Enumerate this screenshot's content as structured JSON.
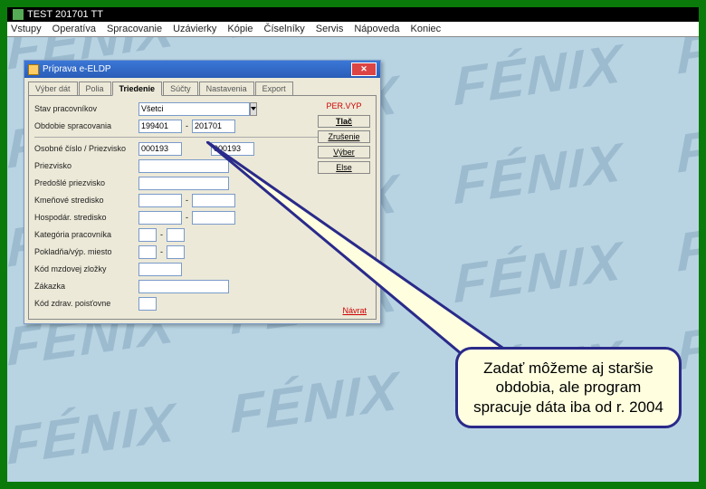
{
  "app": {
    "title": "TEST 201701 TT"
  },
  "menu": [
    "Vstupy",
    "Operatíva",
    "Spracovanie",
    "Uzávierky",
    "Kópie",
    "Číselníky",
    "Servis",
    "Nápoveda",
    "Koniec"
  ],
  "dialog": {
    "title": "Príprava e-ELDP",
    "tabs": [
      "Výber dát",
      "Polia",
      "Triedenie",
      "Súčty",
      "Nastavenia",
      "Export"
    ],
    "active_tab": 2,
    "pervyp": "PER.VYP",
    "buttons": {
      "tlac": "Tlač",
      "zrusenie": "Zrušenie",
      "vyber": "Výber",
      "else": "Else"
    },
    "navrat": "Návrat",
    "fields": {
      "stav_lbl": "Stav pracovníkov",
      "stav_val": "Všetci",
      "obdobie_lbl": "Obdobie spracovania",
      "obdobie_from": "199401",
      "obdobie_to": "201701",
      "oscis_lbl": "Osobné číslo / Priezvisko",
      "oscis_from": "000193",
      "oscis_to": "000193",
      "priezvisko_lbl": "Priezvisko",
      "predosle_lbl": "Predošlé priezvisko",
      "kmen_lbl": "Kmeňové stredisko",
      "hosp_lbl": "Hospodár. stredisko",
      "kateg_lbl": "Kategória pracovníka",
      "pokl_lbl": "Pokladňa/výp. miesto",
      "kodmzd_lbl": "Kód mzdovej zložky",
      "zakazka_lbl": "Zákazka",
      "kodzp_lbl": "Kód zdrav. poisťovne"
    }
  },
  "callout": {
    "text": "Zadať môžeme aj staršie obdobia, ale program spracuje dáta iba od r. 2004"
  }
}
